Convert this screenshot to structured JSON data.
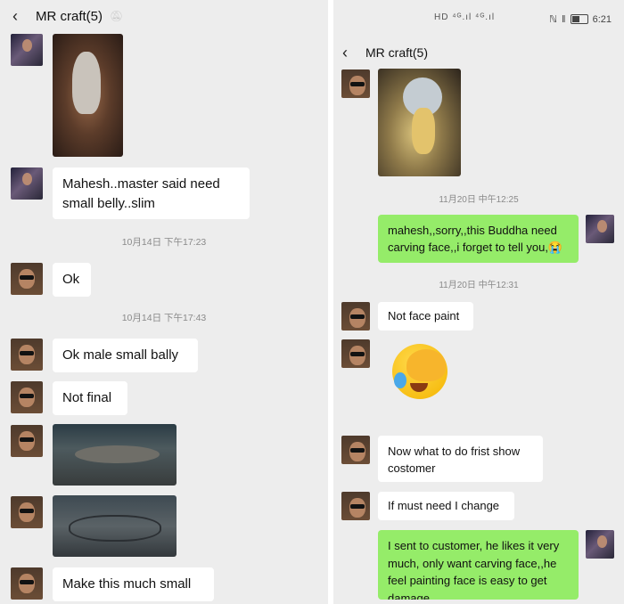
{
  "left": {
    "title": "MR craft(5)",
    "messages": {
      "m1": "Mahesh..master said need\nsmall belly..slim",
      "ts1": "10月14日 下午17:23",
      "m2": "Ok",
      "ts2": "10月14日 下午17:43",
      "m3": "Ok male small bally",
      "m4": "Not final",
      "m5": "Make this much small"
    }
  },
  "right": {
    "status": {
      "signal": "HD ⁴ᴳ.ıl ⁴ᴳ.ıl",
      "time": "6:21"
    },
    "title": "MR craft(5)",
    "messages": {
      "ts1": "11月20日 中午12:25",
      "m1": "mahesh,,sorry,,this Buddha need carving face,,i forget to tell you,😭",
      "ts2": "11月20日 中午12:31",
      "m2": "Not face paint",
      "m3": "Now what to do frist show costomer",
      "m4": "If must need I change",
      "m5": "I sent to customer, he likes it very much, only want carving face,,he feel painting face is easy to get damage"
    }
  },
  "icons": [
    "back-arrow-icon",
    "mute-bell-icon",
    "nfc-icon",
    "vibrate-icon",
    "battery-icon",
    "wifi-icon"
  ]
}
